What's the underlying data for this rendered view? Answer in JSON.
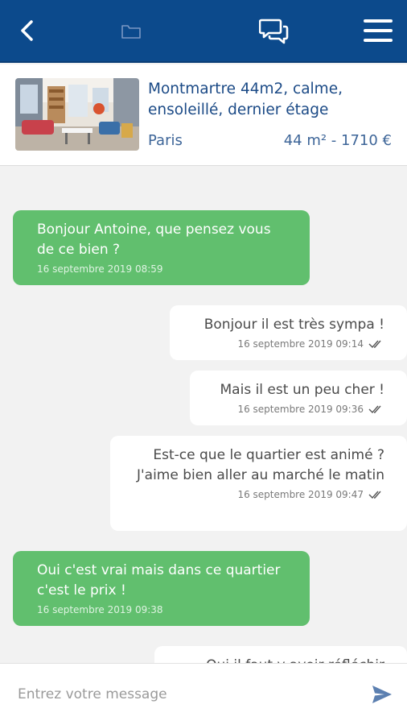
{
  "header": {
    "back_icon": "chevron-left-icon",
    "folder_icon": "folder-icon",
    "chat_icon": "chat-bubbles-icon",
    "menu_icon": "hamburger-menu-icon",
    "background_color": "#0c4a8c"
  },
  "listing": {
    "title": "Montmartre 44m2, calme, ensoleillé, dernier étage",
    "city": "Paris",
    "info": "44 m² - 1710 €"
  },
  "messages": [
    {
      "direction": "in",
      "text": "Bonjour Antoine, que pensez vous de ce bien ?",
      "time": "16 septembre 2019 08:59"
    },
    {
      "direction": "out",
      "text": "Bonjour il est très sympa !",
      "time": "16 septembre 2019 09:14"
    },
    {
      "direction": "out",
      "text": "Mais il est un peu cher !",
      "time": "16 septembre 2019 09:36"
    },
    {
      "direction": "out",
      "text": "Est-ce que le quartier est animé ? J'aime bien aller au marché le matin",
      "time": "16 septembre 2019 09:47"
    },
    {
      "direction": "in",
      "text": "Oui c'est vrai mais dans ce quartier c'est le prix !",
      "time": "16 septembre 2019 09:38"
    },
    {
      "direction": "out",
      "text": "Oui il faut y avoir réfléchir",
      "time": ""
    }
  ],
  "composer": {
    "placeholder": "Entrez votre message",
    "value": "",
    "send_icon": "send-icon"
  },
  "colors": {
    "incoming_bubble": "#61bf6e",
    "outgoing_bubble": "#ffffff",
    "accent": "#1b4a86"
  }
}
